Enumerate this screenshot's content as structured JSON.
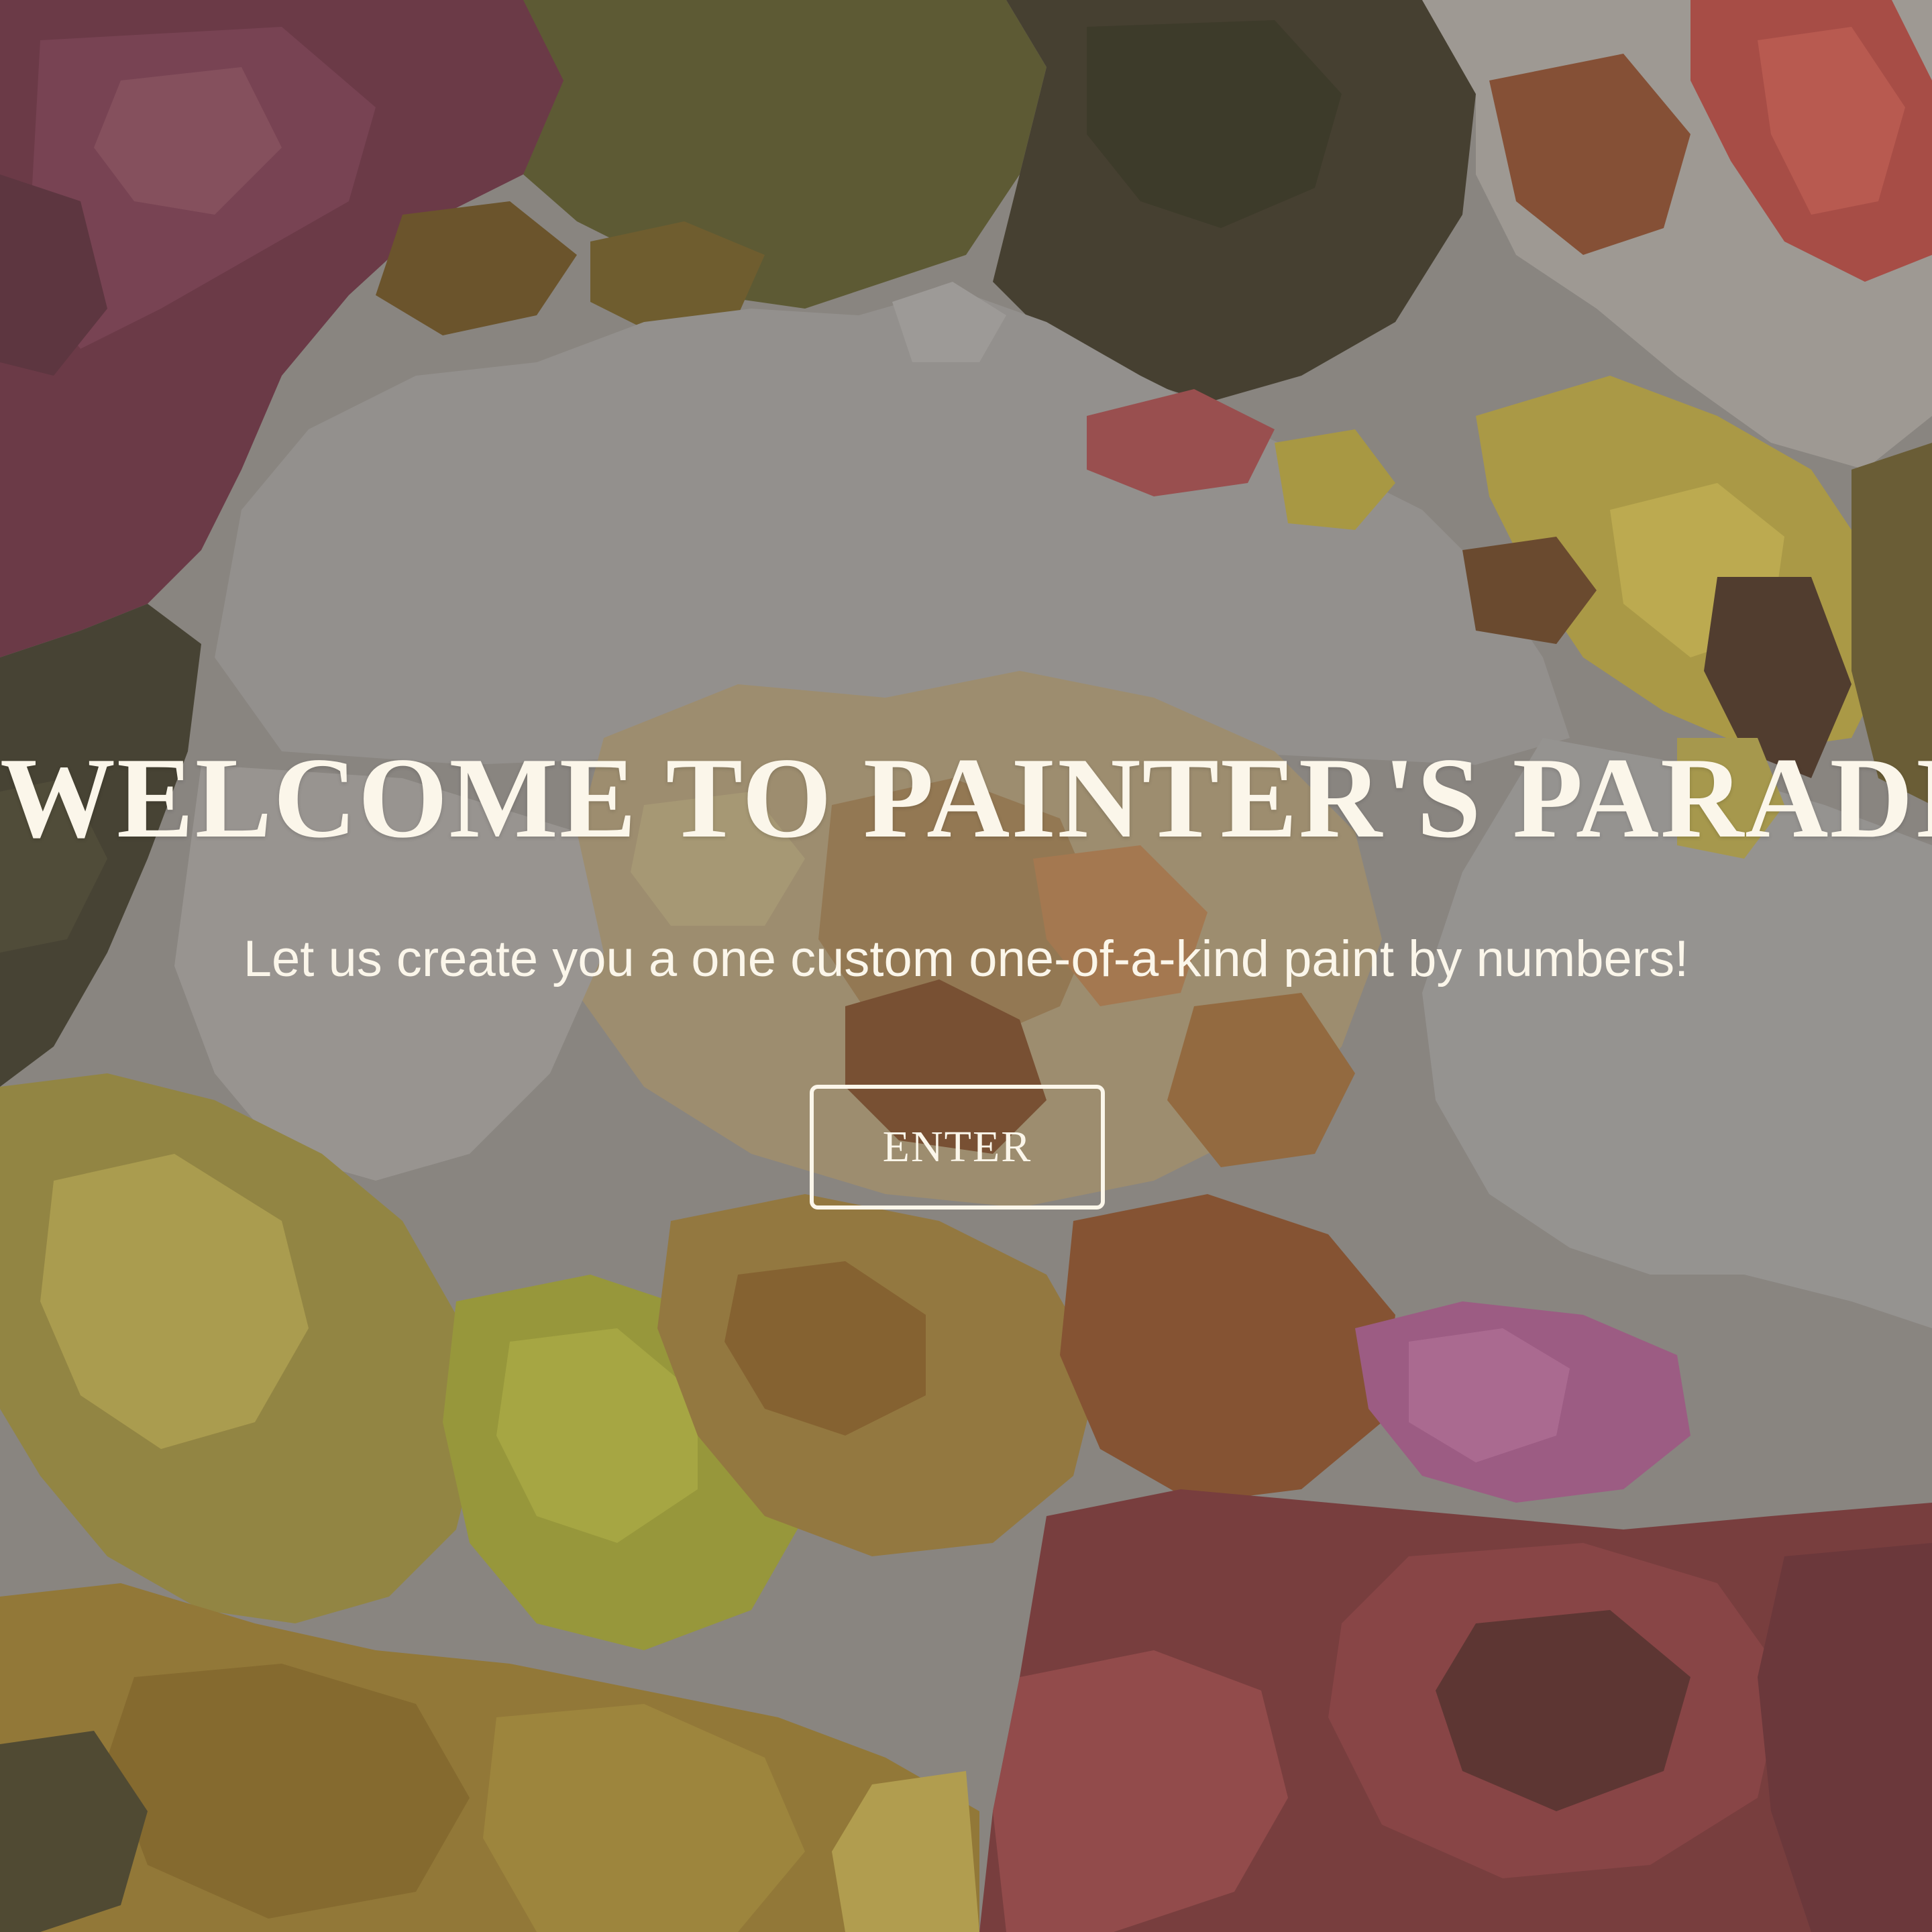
{
  "hero": {
    "title": "WELCOME TO PAINTER'S PARADISE",
    "subtitle": "Let us create you a one custom one-of-a-kind paint by numbers!",
    "enter_label": "ENTER"
  },
  "colors": {
    "text": "#fbf6ea",
    "button_border": "#fbf6ea"
  }
}
